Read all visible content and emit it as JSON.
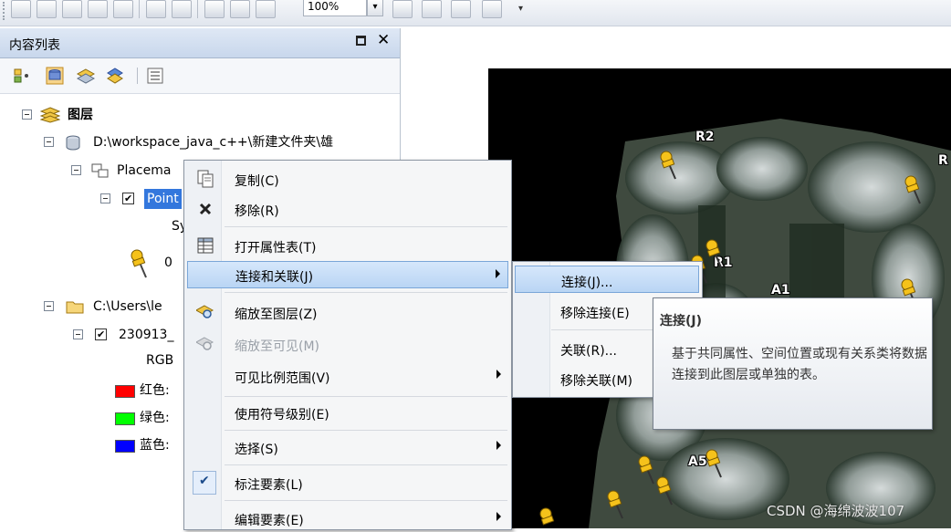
{
  "toolbar": {
    "zoom_value": "100%"
  },
  "toc": {
    "title": "内容列表",
    "pin_label": "□",
    "close_label": "✕",
    "root": "图层",
    "gdb": "D:\\workspace_java_c++\\新建文件夹\\雄",
    "placemarks": "Placema",
    "points": "Point",
    "sym_label": "Sy",
    "sym_value": "0",
    "folder": "C:\\Users\\le",
    "raster": "230913_",
    "rgb": "RGB",
    "red": "红色:",
    "green": "绿色:",
    "blue": "蓝色:",
    "colors": {
      "red": "#ff0000",
      "green": "#00ff00",
      "blue": "#0000ff"
    }
  },
  "map": {
    "labels": {
      "r2": "R2",
      "r1": "R1",
      "a1": "A1",
      "a5": "A5",
      "r_edge": "R"
    }
  },
  "context_menu": {
    "copy": "复制(C)",
    "remove": "移除(R)",
    "open_table": "打开属性表(T)",
    "joins_relates": "连接和关联(J)",
    "zoom_layer": "缩放至图层(Z)",
    "zoom_visible": "缩放至可见(M)",
    "visible_scale": "可见比例范围(V)",
    "symbol_levels": "使用符号级别(E)",
    "selection": "选择(S)",
    "label_features": "标注要素(L)",
    "edit_features": "编辑要素(E)"
  },
  "submenu": {
    "join": "连接(J)...",
    "remove_join": "移除连接(E)",
    "relate": "关联(R)...",
    "remove_relate": "移除关联(M)"
  },
  "tooltip": {
    "title": "连接(J)",
    "body": "基于共同属性、空间位置或现有关系类将数据连接到此图层或单独的表。"
  },
  "watermark": "CSDN @海绵波波107"
}
